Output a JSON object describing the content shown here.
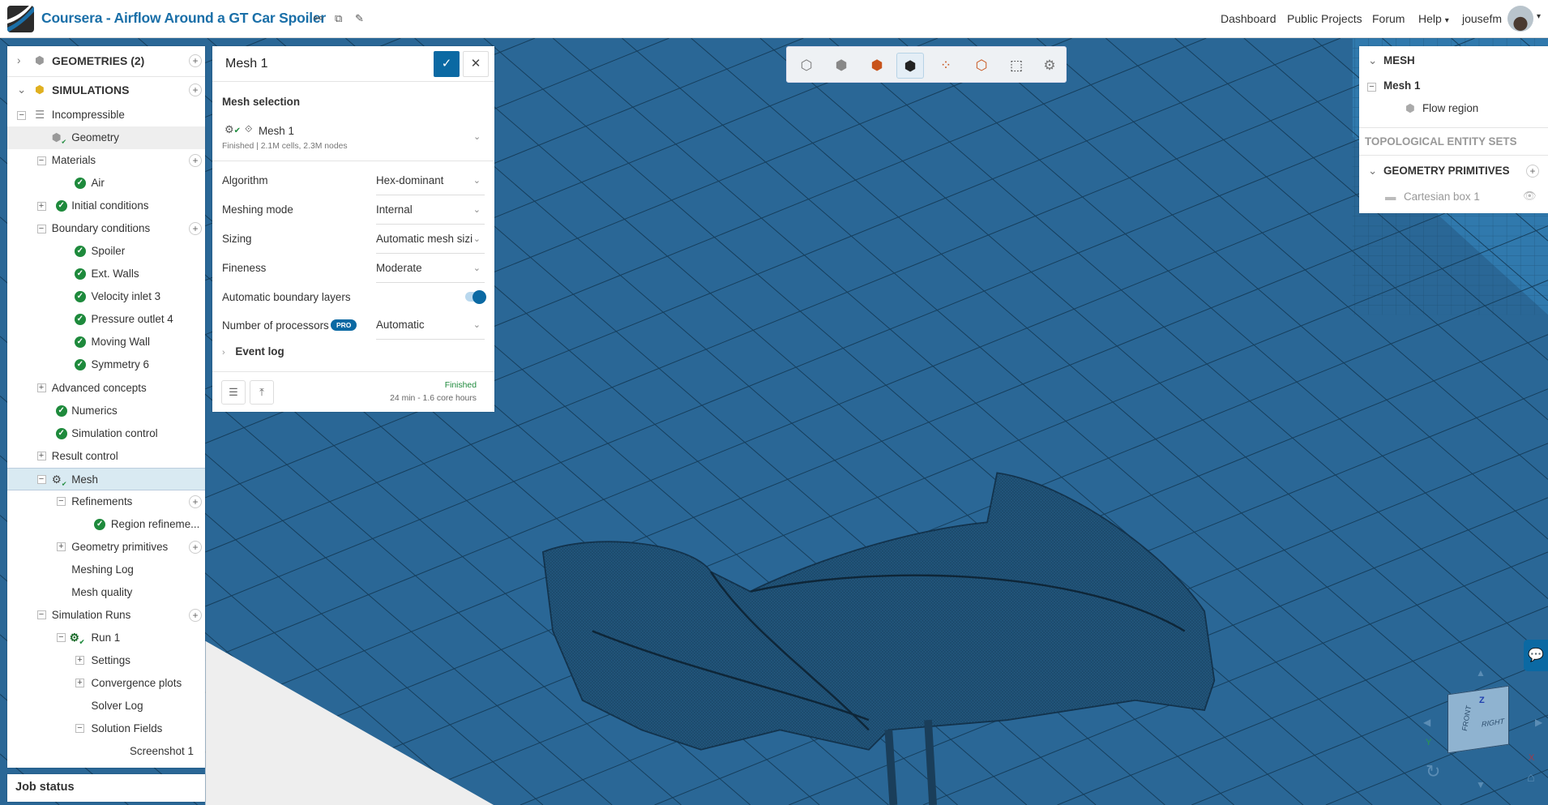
{
  "header": {
    "title": "Coursera - Airflow Around a GT Car Spoiler",
    "nav": [
      "Dashboard",
      "Public Projects",
      "Forum",
      "Help"
    ],
    "username": "jousefm"
  },
  "tree": {
    "geometries": "GEOMETRIES (2)",
    "simulations": "SIMULATIONS",
    "items": [
      "Incompressible",
      "Geometry",
      "Materials",
      "Air",
      "Initial conditions",
      "Boundary conditions",
      "Spoiler",
      "Ext. Walls",
      "Velocity inlet 3",
      "Pressure outlet 4",
      "Moving Wall",
      "Symmetry 6",
      "Advanced concepts",
      "Numerics",
      "Simulation control",
      "Result control",
      "Mesh",
      "Refinements",
      "Region refineme...",
      "Geometry primitives",
      "Meshing Log",
      "Mesh quality",
      "Simulation Runs",
      "Run 1",
      "Settings",
      "Convergence plots",
      "Solver Log",
      "Solution Fields",
      "Screenshot 1"
    ],
    "job_status": "Job status"
  },
  "mesh_panel": {
    "title": "Mesh 1",
    "selection_heading": "Mesh selection",
    "selected_mesh": "Mesh 1",
    "selected_mesh_info": "Finished | 2.1M cells, 2.3M nodes",
    "fields": [
      {
        "label": "Algorithm",
        "value": "Hex-dominant"
      },
      {
        "label": "Meshing mode",
        "value": "Internal"
      },
      {
        "label": "Sizing",
        "value": "Automatic mesh sizi"
      },
      {
        "label": "Fineness",
        "value": "Moderate"
      }
    ],
    "boundary_layers_label": "Automatic boundary layers",
    "boundary_layers_on": true,
    "processors_label": "Number of processors",
    "pro_badge": "PRO",
    "processors_value": "Automatic",
    "event_log": "Event log",
    "status": "Finished",
    "status_detail": "24 min - 1.6 core hours",
    "status_color": "#1e8a3c"
  },
  "right_panel": {
    "mesh_heading": "MESH",
    "mesh_item": "Mesh 1",
    "flow_region": "Flow region",
    "topo_heading": "TOPOLOGICAL ENTITY SETS",
    "primitives_heading": "GEOMETRY PRIMITIVES",
    "cartesian_box": "Cartesian box 1"
  },
  "view_cube": {
    "front": "FRONT",
    "right": "RIGHT",
    "x": "X",
    "y": "Y",
    "z": "Z"
  },
  "colors": {
    "accent": "#0b69a3",
    "viewport": "#2a6796",
    "success": "#1e8a3c"
  }
}
